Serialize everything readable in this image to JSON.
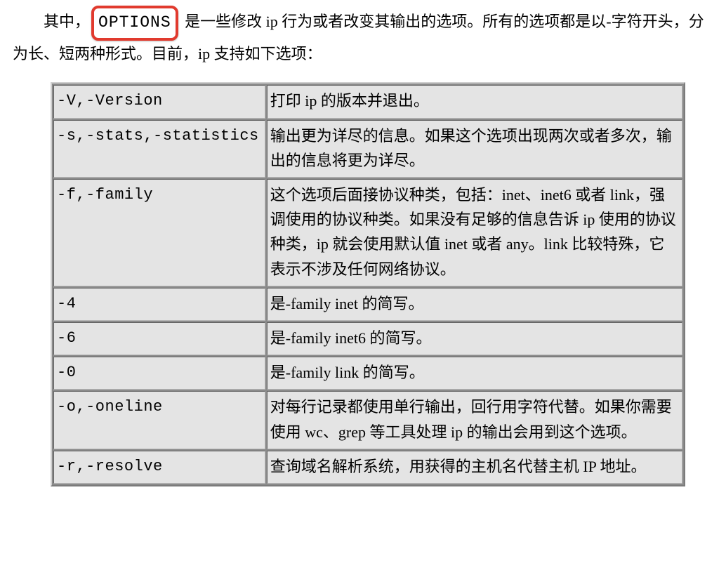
{
  "intro": {
    "prefix": "其中，",
    "highlight": "OPTIONS",
    "rest1": " 是一些修改 ip 行为或者改变其输出的选项。所有的选项都是以-字符开头，分为长、短两种形式。目前，ip 支持如下选项："
  },
  "table": {
    "rows": [
      {
        "option": "-V,-Version",
        "description": "打印 ip 的版本并退出。"
      },
      {
        "option": "-s,-stats,-statistics",
        "description": "输出更为详尽的信息。如果这个选项出现两次或者多次，输出的信息将更为详尽。"
      },
      {
        "option": "-f,-family",
        "description": "这个选项后面接协议种类，包括：inet、inet6 或者 link，强调使用的协议种类。如果没有足够的信息告诉 ip 使用的协议种类，ip 就会使用默认值 inet 或者 any。link 比较特殊，它表示不涉及任何网络协议。"
      },
      {
        "option": "-4",
        "description": "是-family inet 的简写。"
      },
      {
        "option": "-6",
        "description": "是-family inet6 的简写。"
      },
      {
        "option": "-0",
        "description": "是-family link 的简写。"
      },
      {
        "option": "-o,-oneline",
        "description": "对每行记录都使用单行输出，回行用字符代替。如果你需要使用 wc、grep 等工具处理 ip 的输出会用到这个选项。"
      },
      {
        "option": "-r,-resolve",
        "description": "查询域名解析系统，用获得的主机名代替主机 IP 地址。"
      }
    ]
  }
}
